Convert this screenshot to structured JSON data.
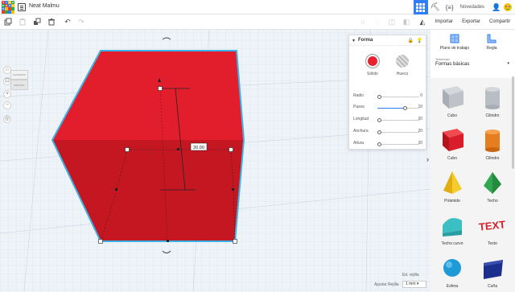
{
  "app": {
    "logo_letters": [
      "T",
      "I",
      "N",
      "K",
      "E",
      "R",
      "C",
      "A",
      "D",
      "",
      "",
      "",
      "",
      "",
      "",
      ""
    ],
    "design_title": "Neat Malmu",
    "news_label": "Novedades"
  },
  "top_icons": [
    "grid-view-icon",
    "pickaxe-icon",
    "code-blocks-icon"
  ],
  "panel_actions": [
    "Importar",
    "Exportar",
    "Compartir"
  ],
  "toolbar": {
    "tools": [
      "copy",
      "paste",
      "duplicate",
      "delete",
      "undo",
      "redo"
    ],
    "view_tools": [
      "light-bulb",
      "note",
      "group",
      "ungroup",
      "align",
      "mirror"
    ]
  },
  "viewcube": {
    "top_label": "SUPERIOR",
    "front_label": "FRONTAL"
  },
  "dimension_label": "20.00",
  "inspector": {
    "title": "Forma",
    "solid_label": "Sólido",
    "hole_label": "Hueco",
    "solid_color": "#e8232f",
    "params": [
      {
        "label": "Radio",
        "value": "0",
        "fraction": 0.0
      },
      {
        "label": "Pasos",
        "value": "10",
        "fraction": 0.65
      },
      {
        "label": "Longitud",
        "value": "20",
        "fraction": 0.0
      },
      {
        "label": "Anchura",
        "value": "20",
        "fraction": 0.0
      },
      {
        "label": "Altura",
        "value": "20",
        "fraction": 0.0
      }
    ]
  },
  "sidebar": {
    "workplane_label": "Plano de trabajo",
    "ruler_label": "Regla",
    "category_small": "Tinkercad",
    "category": "Formas básicas",
    "shapes": [
      {
        "label": "Cubo",
        "color": "#b9bdc4"
      },
      {
        "label": "Cilindro",
        "color": "#b9bdc4"
      },
      {
        "label": "Cubo",
        "color": "#e0232e"
      },
      {
        "label": "Cilindro",
        "color": "#e67e1f"
      },
      {
        "label": "Pirámide",
        "color": "#f2c21b"
      },
      {
        "label": "Techo",
        "color": "#2fa84f"
      },
      {
        "label": "Techo curvo",
        "color": "#3cbfc4"
      },
      {
        "label": "Texto",
        "color": "#d4202a"
      },
      {
        "label": "Esfera",
        "color": "#1e9bd7"
      },
      {
        "label": "Cuña",
        "color": "#1d2f8c"
      }
    ]
  },
  "bottom": {
    "edit_grid": "Ed. rejilla",
    "snap_label": "Ajustar Rejilla",
    "snap_value": "1 mm"
  }
}
